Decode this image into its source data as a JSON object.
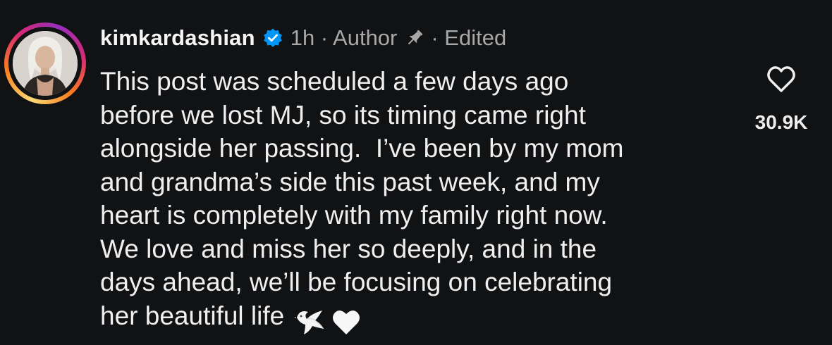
{
  "comment": {
    "username": "kimkardashian",
    "meta_line": "1h · Author",
    "edited_label": "· Edited",
    "text_lines": [
      "This post was scheduled a few days ago",
      "before we lost MJ, so its timing came right",
      "alongside her passing.  I’ve been by my mom",
      "and grandma’s side this past week, and my",
      "heart is completely with my family right now.",
      "We love and miss her so deeply, and in the",
      "days ahead, we’ll be focusing on celebrating",
      "her beautiful life"
    ],
    "emojis": [
      "dove-emoji",
      "white-heart-emoji"
    ],
    "like_count": "30.9K"
  },
  "icons": {
    "verified": "verified-badge-icon",
    "pin": "pin-icon",
    "like": "heart-outline-icon"
  },
  "colors": {
    "background": "#111214",
    "text": "#efefef",
    "meta": "#a8a8a8",
    "verified": "#0095f6"
  }
}
